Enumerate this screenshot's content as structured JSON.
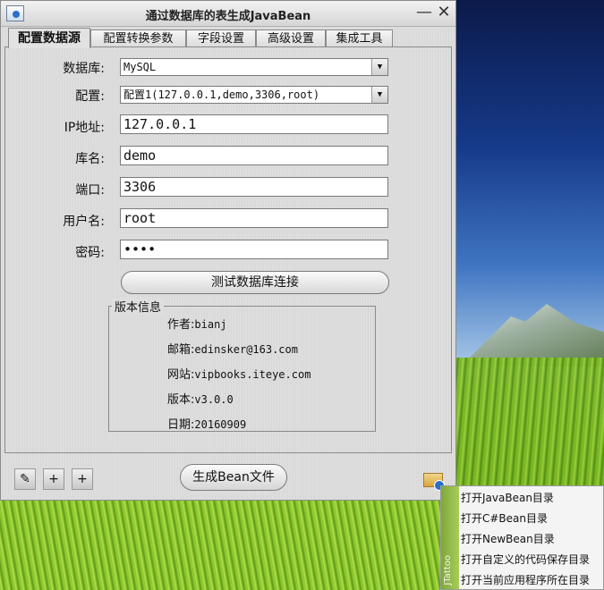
{
  "window": {
    "title": "通过数据库的表生成JavaBean",
    "minimize": "—",
    "close": "✕"
  },
  "tabs": [
    {
      "label": "配置数据源"
    },
    {
      "label": "配置转换参数"
    },
    {
      "label": "字段设置"
    },
    {
      "label": "高级设置"
    },
    {
      "label": "集成工具"
    }
  ],
  "form": {
    "db_label": "数据库:",
    "db_value": "MySQL",
    "config_label": "配置:",
    "config_value": "配置1(127.0.0.1,demo,3306,root)",
    "ip_label": "IP地址:",
    "ip_value": "127.0.0.1",
    "lib_label": "库名:",
    "lib_value": "demo",
    "port_label": "端口:",
    "port_value": "3306",
    "user_label": "用户名:",
    "user_value": "root",
    "pwd_label": "密码:",
    "pwd_value": "••••",
    "test_button": "测试数据库连接"
  },
  "version": {
    "title": "版本信息",
    "author_label": "作者:",
    "author": "bianj",
    "email_label": "邮箱:",
    "email": "edinsker@163.com",
    "site_label": "网站:",
    "site": "vipbooks.iteye.com",
    "ver_label": "版本:",
    "ver": "v3.0.0",
    "date_label": "日期:",
    "date": "20160909"
  },
  "toolbar": {
    "generate_button": "生成Bean文件"
  },
  "context_menu": {
    "side_label": "JTattoo",
    "items": [
      "打开JavaBean目录",
      "打开C#Bean目录",
      "打开NewBean目录",
      "打开自定义的代码保存目录",
      "打开当前应用程序所在目录"
    ]
  }
}
